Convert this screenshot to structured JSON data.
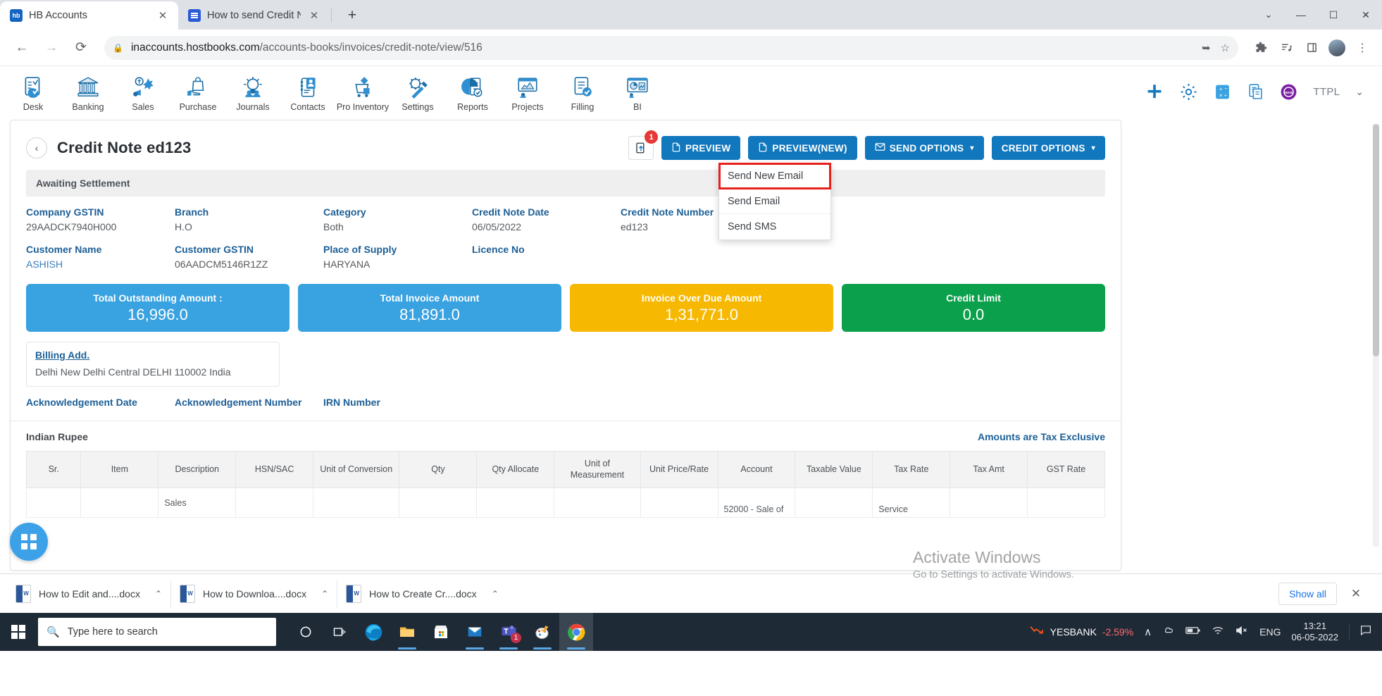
{
  "browser": {
    "tabs": [
      {
        "title": "HB Accounts",
        "favicon": "hb-favicon",
        "active": true,
        "close_label": "✕"
      },
      {
        "title": "How to send Credit Note on mai",
        "favicon": "google-docs-favicon",
        "active": false,
        "close_label": "✕"
      }
    ],
    "new_tab_label": "+",
    "window_controls": {
      "minimize": "—",
      "maximize": "☐",
      "close": "✕",
      "tab_search": "⌄"
    },
    "nav": {
      "back": "←",
      "forward": "→",
      "reload": "⟳"
    },
    "omnibox": {
      "lock_icon": "lock-icon",
      "host": "inaccounts.hostbooks.com",
      "path": "/accounts-books/invoices/credit-note/view/516",
      "share_icon": "share-icon",
      "bookmark_icon": "star-icon"
    },
    "toolbar_icons": [
      "extensions-puzzle-icon",
      "reading-list-icon",
      "sidepanel-icon",
      "profile-avatar",
      "chrome-menu-icon"
    ]
  },
  "appnav": {
    "items": [
      {
        "label": "Desk",
        "icon": "desk-icon"
      },
      {
        "label": "Banking",
        "icon": "bank-icon"
      },
      {
        "label": "Sales",
        "icon": "sales-icon"
      },
      {
        "label": "Purchase",
        "icon": "purchase-icon"
      },
      {
        "label": "Journals",
        "icon": "journals-icon"
      },
      {
        "label": "Contacts",
        "icon": "contacts-icon"
      },
      {
        "label": "Pro Inventory",
        "icon": "inventory-icon"
      },
      {
        "label": "Settings",
        "icon": "settings-tools-icon"
      },
      {
        "label": "Reports",
        "icon": "reports-icon"
      },
      {
        "label": "Projects",
        "icon": "projects-icon"
      },
      {
        "label": "Filling",
        "icon": "filling-icon"
      },
      {
        "label": "BI",
        "icon": "bi-icon"
      }
    ],
    "right": {
      "add_icon": "plus-icon",
      "gear_icon": "gear-icon",
      "calculator_icon": "calculator-icon",
      "notes_icon": "notes-icon",
      "new_badge_icon": "new-badge-icon",
      "company": "TTPL",
      "chevron": "⌄"
    }
  },
  "page": {
    "back_icon": "‹",
    "title": "Credit Note ed123",
    "actions": {
      "share_icon_btn": "share-upload-icon",
      "share_badge": "1",
      "preview": "PREVIEW",
      "preview_new": "PREVIEW(NEW)",
      "send_options": "SEND OPTIONS",
      "credit_options": "CREDIT OPTIONS",
      "caret": "▾",
      "pdf_icon": "pdf-icon",
      "mail_icon": "mail-icon"
    },
    "send_options_menu": [
      {
        "label": "Send New Email",
        "highlighted": true
      },
      {
        "label": "Send Email",
        "highlighted": false
      },
      {
        "label": "Send SMS",
        "highlighted": false
      }
    ],
    "status": "Awaiting Settlement",
    "fields_row1": [
      {
        "label": "Company GSTIN",
        "value": "29AADCK7940H000"
      },
      {
        "label": "Branch",
        "value": "H.O"
      },
      {
        "label": "Category",
        "value": "Both"
      },
      {
        "label": "Credit Note Date",
        "value": "06/05/2022"
      },
      {
        "label": "Credit Note Number",
        "value": "ed123"
      }
    ],
    "fields_row2": [
      {
        "label": "Customer Name",
        "value": "ASHISH",
        "link": true
      },
      {
        "label": "Customer GSTIN",
        "value": "06AADCM5146R1ZZ"
      },
      {
        "label": "Place of Supply",
        "value": "HARYANA"
      },
      {
        "label": "Licence No",
        "value": ""
      }
    ],
    "kpis": [
      {
        "label": "Total Outstanding Amount :",
        "value": "16,996.0",
        "color": "#39a2e0"
      },
      {
        "label": "Total Invoice Amount",
        "value": "81,891.0",
        "color": "#39a2e0"
      },
      {
        "label": "Invoice Over Due Amount",
        "value": "1,31,771.0",
        "color": "#f6b800"
      },
      {
        "label": "Credit Limit",
        "value": "0.0",
        "color": "#0aa04c"
      }
    ],
    "billing": {
      "title": "Billing Add.",
      "text": "Delhi New Delhi Central DELHI 110002 India"
    },
    "ack_labels": [
      "Acknowledgement Date",
      "Acknowledgement Number",
      "IRN Number"
    ],
    "currency": "Indian Rupee",
    "tax_note": "Amounts are Tax Exclusive",
    "table": {
      "columns": [
        "Sr.",
        "Item",
        "Description",
        "HSN/SAC",
        "Unit of Conversion",
        "Qty",
        "Qty Allocate",
        "Unit of Measurement",
        "Unit Price/Rate",
        "Account",
        "Taxable Value",
        "Tax Rate",
        "Tax Amt",
        "GST Rate"
      ],
      "rows": [
        [
          "",
          "",
          "Sales",
          "",
          "",
          "",
          "",
          "",
          "",
          "52000 - Sale of",
          "",
          "Service",
          "",
          ""
        ]
      ]
    },
    "grid_fab_icon": "grid-apps-icon"
  },
  "watermark": {
    "line1": "Activate Windows",
    "line2": "Go to Settings to activate Windows."
  },
  "downloads": {
    "items": [
      {
        "name": "How to Edit and....docx",
        "caret": "⌃"
      },
      {
        "name": "How to Downloa....docx",
        "caret": "⌃"
      },
      {
        "name": "How to Create Cr....docx",
        "caret": "⌃"
      }
    ],
    "show_all": "Show all",
    "close": "✕"
  },
  "taskbar": {
    "start_icon": "windows-start-icon",
    "search_placeholder": "Type here to search",
    "search_icon": "search-icon",
    "pinned": [
      "cortana-icon",
      "task-view-icon",
      "edge-icon",
      "file-explorer-icon",
      "microsoft-store-icon",
      "mail-icon",
      "teams-icon",
      "paint-icon",
      "chrome-icon"
    ],
    "tray": {
      "stock_name": "YESBANK",
      "stock_change": "-2.59%",
      "stock_icon": "stock-down-icon",
      "overflow": "∧",
      "icons": [
        "onedrive-icon",
        "battery-icon",
        "wifi-icon",
        "volume-muted-icon"
      ],
      "language": "ENG",
      "time": "13:21",
      "date": "06-05-2022",
      "notifications_icon": "notification-icon"
    }
  }
}
